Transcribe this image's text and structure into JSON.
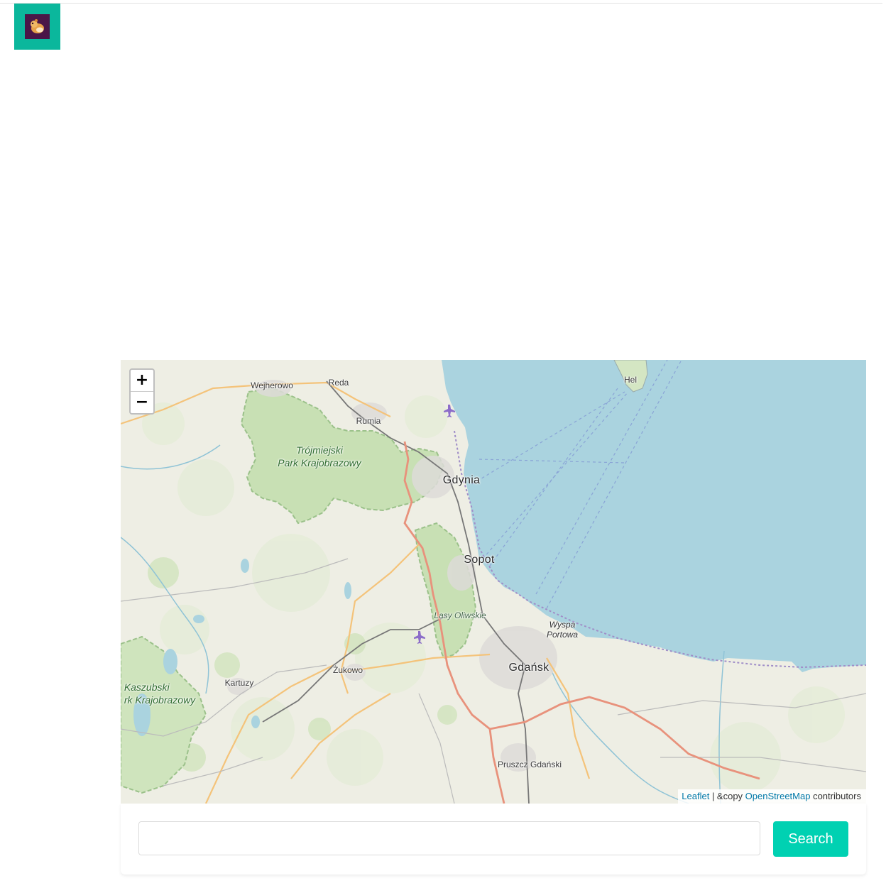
{
  "header": {
    "logo_icon": "hamster-logo-icon",
    "logo_bg": "#0bb79c"
  },
  "map": {
    "labels": {
      "wejherowo": "Wejherowo",
      "reda": "Reda",
      "rumia": "Rumia",
      "hel": "Hel",
      "park_line1": "Trójmiejski",
      "park_line2": "Park Krajobrazowy",
      "gdynia": "Gdynia",
      "sopot": "Sopot",
      "lasy_oliwskie": "Lasy Oliwskie",
      "wyspa_line1": "Wyspa",
      "wyspa_line2": "Portowa",
      "gdansk": "Gdańsk",
      "zukowo": "Żukowo",
      "kartuzy": "Kartuzy",
      "kaszubski_line1": "Kaszubski",
      "kaszubski_line2": "rk Krajobrazowy",
      "pruszcz": "Pruszcz Gdański"
    },
    "zoom_in_label": "+",
    "zoom_out_label": "−",
    "attribution": {
      "leaflet": "Leaflet",
      "sep": " | &copy ",
      "osm": "OpenStreetMap",
      "suffix": " contributors"
    },
    "colors": {
      "water": "#aad3df",
      "land": "#eeeee4",
      "park": "#c8e0b4",
      "motorway": "#e8927c",
      "primary": "#f4c37a"
    }
  },
  "search": {
    "input_value": "",
    "placeholder": "",
    "button_label": "Search",
    "button_color": "#00d1b2"
  }
}
